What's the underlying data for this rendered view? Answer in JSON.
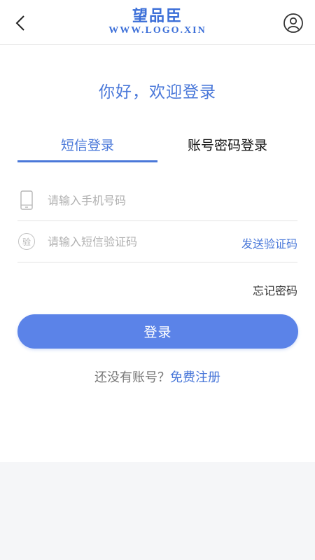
{
  "header": {
    "logo_cn": "望品臣",
    "logo_en": "WWW.LOGO.XIN",
    "back_icon": "chevron-left-icon",
    "user_icon": "user-circle-icon"
  },
  "greeting": "你好，欢迎登录",
  "tabs": [
    {
      "label": "短信登录",
      "active": true
    },
    {
      "label": "账号密码登录",
      "active": false
    }
  ],
  "form": {
    "phone": {
      "placeholder": "请输入手机号码",
      "value": "",
      "icon": "phone-icon"
    },
    "code": {
      "placeholder": "请输入短信验证码",
      "value": "",
      "icon_text": "验"
    },
    "send_code_label": "发送验证码",
    "forgot_password_label": "忘记密码",
    "login_label": "登录"
  },
  "register": {
    "prompt": "还没有账号？",
    "link": "免费注册"
  },
  "colors": {
    "accent": "#4a78d9",
    "button": "#5b83e8",
    "background": "#f5f6f8"
  }
}
